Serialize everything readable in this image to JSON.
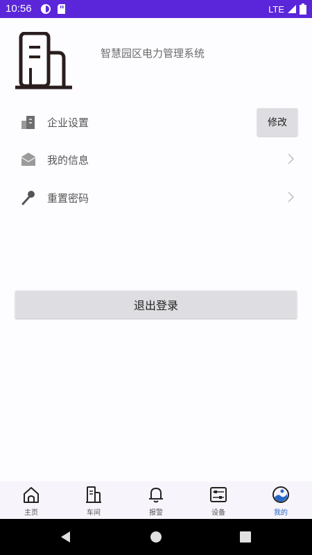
{
  "status_bar": {
    "time": "10:56",
    "network": "LTE"
  },
  "header": {
    "title": "智慧园区电力管理系统",
    "logo_icon": "building-icon"
  },
  "menu": {
    "items": [
      {
        "label": "企业设置",
        "icon": "enterprise-building-icon",
        "action_label": "修改"
      },
      {
        "label": "我的信息",
        "icon": "mail-icon"
      },
      {
        "label": "重置密码",
        "icon": "key-icon"
      }
    ]
  },
  "logout": {
    "label": "退出登录"
  },
  "bottom_nav": {
    "items": [
      {
        "label": "主页",
        "icon": "home-icon"
      },
      {
        "label": "车间",
        "icon": "workshop-icon"
      },
      {
        "label": "报警",
        "icon": "bell-icon"
      },
      {
        "label": "设备",
        "icon": "device-icon"
      },
      {
        "label": "我的",
        "icon": "profile-icon",
        "active": true
      }
    ]
  },
  "colors": {
    "status_bar": "#5b26d9",
    "active_nav": "#2466c7",
    "button_bg": "#dedde1"
  }
}
